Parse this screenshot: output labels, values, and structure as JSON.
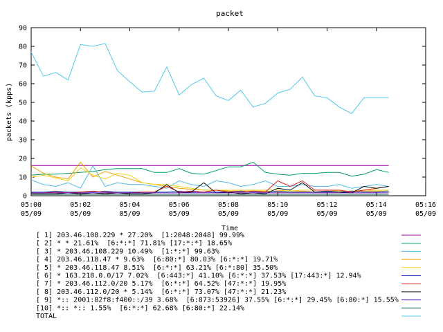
{
  "chart_data": {
    "type": "line",
    "title": "packet",
    "xlabel": "Time",
    "ylabel": "packets (kpps)",
    "xlim": [
      "05:00",
      "05:16"
    ],
    "ylim": [
      0,
      90
    ],
    "yticks": [
      "0",
      "10",
      "20",
      "30",
      "40",
      "50",
      "60",
      "70",
      "80",
      "90"
    ],
    "xticks": [
      {
        "time": "05:00",
        "date": "05/09"
      },
      {
        "time": "05:02",
        "date": "05/09"
      },
      {
        "time": "05:04",
        "date": "05/09"
      },
      {
        "time": "05:06",
        "date": "05/09"
      },
      {
        "time": "05:08",
        "date": "05/09"
      },
      {
        "time": "05:10",
        "date": "05/09"
      },
      {
        "time": "05:12",
        "date": "05/09"
      },
      {
        "time": "05:14",
        "date": "05/09"
      },
      {
        "time": "05:16",
        "date": "05/09"
      }
    ],
    "grid": false,
    "legend_position": "bottom",
    "x": [
      "05:00",
      "05:00:30",
      "05:01",
      "05:01:30",
      "05:02",
      "05:02:30",
      "05:03",
      "05:03:30",
      "05:04",
      "05:04:30",
      "05:05",
      "05:05:30",
      "05:06",
      "05:06:30",
      "05:07",
      "05:07:30",
      "05:08",
      "05:08:30",
      "05:09",
      "05:09:30",
      "05:10",
      "05:10:30",
      "05:11",
      "05:11:30",
      "05:12",
      "05:12:30",
      "05:13",
      "05:13:30",
      "05:14",
      "05:14:30"
    ],
    "series": [
      {
        "name": "[ 1] 203.46.108.229 * 27.20%  [1:2048:2048] 99.99%",
        "color": "#a000a0",
        "values": [
          16.2,
          16.2,
          16.2,
          16.2,
          16.2,
          16.2,
          16.2,
          16.2,
          16.2,
          16.2,
          16.2,
          16.2,
          16.2,
          16.2,
          16.2,
          16.2,
          16.2,
          16.2,
          16.2,
          16.2,
          16.2,
          16.2,
          16.2,
          16.2,
          16.2,
          16.2,
          16.2,
          16.2,
          16.2,
          16.2
        ]
      },
      {
        "name": "[ 2] * * 21.61%  [6:*:*] 71.81% [17:*:*] 18.65%",
        "color": "#00a060",
        "values": [
          11,
          11.5,
          11.5,
          12,
          12.5,
          13,
          14,
          14.5,
          14.5,
          14.5,
          12.5,
          12.5,
          14.5,
          12,
          11.5,
          13.5,
          15.5,
          15.5,
          18,
          12.5,
          11.5,
          11,
          12,
          12,
          12.5,
          12.5,
          10.5,
          11.5,
          14,
          12.5
        ]
      },
      {
        "name": "[ 3] * 203.46.108.229 10.49%  [1:*:*] 99.63%",
        "color": "#50b8e8",
        "values": [
          8.5,
          6,
          5,
          7,
          4,
          16,
          5,
          7,
          6,
          6,
          5,
          4,
          8,
          6,
          5,
          8,
          7,
          5,
          6,
          8,
          5,
          5,
          6,
          5,
          5,
          6,
          4,
          5,
          6,
          5
        ]
      },
      {
        "name": "[ 4] 203.46.118.47 * 9.63%  [6:80:*] 80.03% [6:*:*] 19.71%",
        "color": "#f0a000",
        "values": [
          16,
          12,
          10,
          9,
          18,
          10,
          13,
          11,
          9,
          7,
          6,
          5,
          4,
          3.5,
          3,
          3,
          2.5,
          2.5,
          2.5,
          2.5,
          2,
          2,
          2.5,
          2,
          2.5,
          2,
          2,
          2.5,
          2.5,
          2.5
        ]
      },
      {
        "name": "[ 5] * 203.46.118.47 8.51%  [6:*:*] 63.21% [6:*:80] 35.50%",
        "color": "#f0d020",
        "values": [
          10,
          11,
          9.5,
          8,
          15,
          11,
          9,
          12,
          11,
          7,
          6,
          6,
          5,
          4,
          3,
          3,
          3,
          3,
          3,
          3,
          3,
          2.5,
          3,
          3,
          3,
          2.5,
          2.5,
          3,
          3,
          3
        ]
      },
      {
        "name": "[ 6] * 163.218.0.0/17 7.02%  [6:443:*] 41.10% [6:*:*] 37.53% [17:443:*] 12.94%",
        "color": "#2050c0",
        "values": [
          2,
          2,
          2.5,
          2,
          2,
          2,
          2.5,
          2,
          2,
          2,
          2,
          2,
          2.5,
          2,
          2,
          2,
          2,
          2.5,
          2,
          2,
          2.5,
          2,
          2,
          2,
          2.5,
          2,
          2.5,
          2,
          2,
          2.5
        ]
      },
      {
        "name": "[ 7] * 203.46.112.0/20 5.17%  [6:*:*] 64.52% [47:*:*] 19.95%",
        "color": "#e02020",
        "values": [
          1.5,
          1.5,
          2,
          1.5,
          2,
          2.5,
          2,
          1.5,
          1.5,
          2,
          2,
          5,
          2,
          2.5,
          2,
          3,
          2,
          2,
          2.5,
          2,
          8,
          5,
          8,
          3,
          3,
          3,
          2,
          3,
          4,
          5
        ]
      },
      {
        "name": "[ 8] 203.46.112.0/20 * 5.14%  [6:*:*] 73.07% [47:*:*] 21.23%",
        "color": "#101010",
        "values": [
          1,
          1,
          1,
          1.5,
          1,
          1.5,
          1,
          1.5,
          1,
          1,
          1.5,
          6,
          1.5,
          2,
          7,
          1.5,
          2,
          1,
          1.5,
          1,
          4,
          3,
          7,
          2,
          2,
          2,
          1.5,
          5,
          4,
          5
        ]
      },
      {
        "name": "[ 9] *:: 2001:82f8:f400::/39 3.68%  [6:873:53926] 37.55% [6:*:*] 29.45% [6:80:*] 15.55%",
        "color": "#5000b0",
        "values": [
          1.5,
          1.5,
          1.5,
          1.5,
          1.5,
          1.5,
          1.5,
          1.5,
          1.5,
          1.5,
          1.5,
          1.5,
          1.5,
          1.5,
          1.5,
          1.5,
          1.5,
          1.5,
          1.5,
          1.5,
          1.5,
          1.5,
          1.5,
          1.5,
          1.5,
          1.5,
          1.5,
          1.5,
          1.5,
          1.5
        ]
      },
      {
        "name": "[10] *:: *:: 1.55%  [6:*:*] 62.68% [6:80:*] 22.14%",
        "color": "#107050",
        "values": [
          0.7,
          0.7,
          0.7,
          0.7,
          0.7,
          0.7,
          0.7,
          0.7,
          0.7,
          0.7,
          0.7,
          0.7,
          0.7,
          0.7,
          0.7,
          0.7,
          0.7,
          0.7,
          0.7,
          0.7,
          0.7,
          0.7,
          0.7,
          0.7,
          0.7,
          0.7,
          0.7,
          0.7,
          0.7,
          0.7
        ]
      },
      {
        "name": "TOTAL",
        "color": "#50c8e8",
        "values": [
          77,
          64,
          66,
          62,
          81,
          80,
          81.5,
          67,
          61,
          55.5,
          56,
          69,
          54,
          59.5,
          63,
          53.5,
          51,
          56.5,
          47.5,
          49.5,
          55,
          57,
          63.5,
          53.5,
          52.5,
          47.5,
          44,
          52.5,
          52.5,
          52.5
        ]
      }
    ]
  }
}
